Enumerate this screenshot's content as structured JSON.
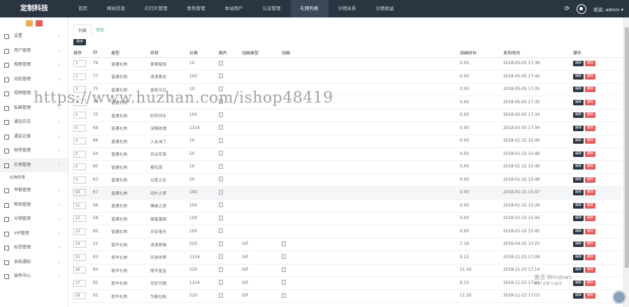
{
  "header": {
    "brand": "定制科技",
    "nav": [
      "首页",
      "网站信息",
      "幻灯片管理",
      "角色管理",
      "本站用户",
      "认证管理",
      "礼物列表",
      "分销关系",
      "分销收益"
    ],
    "active_nav_index": 6,
    "user": "欢迎, admin ▾"
  },
  "sidebar": {
    "items": [
      {
        "label": "设置"
      },
      {
        "label": "用户管理"
      },
      {
        "label": "相册管理"
      },
      {
        "label": "动态管理"
      },
      {
        "label": "视频管理"
      },
      {
        "label": "私聊管理"
      },
      {
        "label": "通话日志"
      },
      {
        "label": "通话记录"
      },
      {
        "label": "财务管理"
      },
      {
        "label": "礼物管理"
      },
      {
        "label": "举报管理"
      },
      {
        "label": "帮助管理"
      },
      {
        "label": "分销管理"
      },
      {
        "label": "VIP管理"
      },
      {
        "label": "标签管理"
      },
      {
        "label": "系统通知"
      },
      {
        "label": "插件中心"
      }
    ],
    "active_item_index": 9,
    "sub_item": "礼物列表"
  },
  "main": {
    "tabs": [
      "列表",
      "添加"
    ],
    "sort_button": "排序",
    "columns": [
      "排序",
      "ID",
      "类型",
      "名称",
      "价格",
      "图片",
      "动画类型",
      "动画",
      "动画时长",
      "发布时间",
      "操作"
    ],
    "edit_label": "编辑",
    "delete_label": "删除",
    "rows": [
      {
        "order": "1",
        "id": "76",
        "type": "普通礼物",
        "name": "香薰蜡烛",
        "price": "10",
        "anim_type": "",
        "duration": "0.00",
        "time": "2018-05-05 17:39"
      },
      {
        "order": "2",
        "id": "77",
        "type": "普通礼物",
        "name": "浪漫薰衣",
        "price": "100",
        "anim_type": "",
        "duration": "0.00",
        "time": "2018-05-05 17:40"
      },
      {
        "order": "3",
        "id": "75",
        "type": "普通礼物",
        "name": "香氛头灯",
        "price": "10",
        "anim_type": "",
        "duration": "0.00",
        "time": "2018-05-05 17:35"
      },
      {
        "order": "4",
        "id": "74",
        "type": "普通礼物",
        "name": "",
        "price": "",
        "anim_type": "",
        "duration": "0.00",
        "time": "2018-05-05 17:35"
      },
      {
        "order": "5",
        "id": "70",
        "type": "普通礼物",
        "name": "好转风车",
        "price": "100",
        "anim_type": "",
        "duration": "0.00",
        "time": "2018-05-05 17:34"
      },
      {
        "order": "6",
        "id": "69",
        "type": "普通礼物",
        "name": "深情玫瑰",
        "price": "1314",
        "anim_type": "",
        "duration": "0.00",
        "time": "2018-05-05 17:34"
      },
      {
        "order": "0",
        "id": "66",
        "type": "普通礼物",
        "name": "入会油了",
        "price": "10",
        "anim_type": "",
        "duration": "0.00",
        "time": "2018-01-15 15:49"
      },
      {
        "order": "0",
        "id": "64",
        "type": "普通礼物",
        "name": "百合花束",
        "price": "50",
        "anim_type": "",
        "duration": "0.00",
        "time": "2018-01-15 15:48"
      },
      {
        "order": "0",
        "id": "65",
        "type": "普通礼物",
        "name": "樱花雨",
        "price": "10",
        "anim_type": "",
        "duration": "0.00",
        "time": "2018-01-15 15:48"
      },
      {
        "order": "0",
        "id": "63",
        "type": "普通礼物",
        "name": "以爱之名",
        "price": "50",
        "anim_type": "",
        "duration": "0.00",
        "time": "2018-01-15 15:48"
      },
      {
        "order": "10",
        "id": "67",
        "type": "普通礼物",
        "name": "四叶之草",
        "price": "100",
        "anim_type": "",
        "duration": "0.00",
        "time": "2018-01-15 15:47"
      },
      {
        "order": "11",
        "id": "56",
        "type": "普通礼物",
        "name": "情缘之夜",
        "price": "100",
        "anim_type": "",
        "duration": "0.00",
        "time": "2018-01-15 15:39"
      },
      {
        "order": "12",
        "id": "58",
        "type": "普通礼物",
        "name": "甜蜜蛋糕",
        "price": "100",
        "anim_type": "",
        "duration": "0.00",
        "time": "2018-01-15 15:44"
      },
      {
        "order": "13",
        "id": "60",
        "type": "普通礼物",
        "name": "总有笔仓",
        "price": "100",
        "anim_type": "",
        "duration": "0.00",
        "time": "2018-01-15 15:45"
      },
      {
        "order": "14",
        "id": "22",
        "type": "豪华礼物",
        "name": "浪漫爱情",
        "price": "520",
        "anim_type": "GIF",
        "duration": "7.18",
        "time": "2016-04-25 10:25"
      },
      {
        "order": "15",
        "id": "83",
        "type": "豪华礼物",
        "name": "环游世界",
        "price": "1314",
        "anim_type": "GIF",
        "duration": "9.12",
        "time": "2018-11-23 17:08"
      },
      {
        "order": "16",
        "id": "84",
        "type": "豪华礼物",
        "name": "摩天星音",
        "price": "520",
        "anim_type": "GIF",
        "duration": "11.10",
        "time": "2018-11-23 17:14"
      },
      {
        "order": "17",
        "id": "82",
        "type": "豪华礼物",
        "name": "花好月圆",
        "price": "1314",
        "anim_type": "GIF",
        "duration": "8.10",
        "time": "2018-11-23 17:01"
      },
      {
        "order": "18",
        "id": "81",
        "type": "豪华礼物",
        "name": "为霸在船",
        "price": "520",
        "anim_type": "GIF",
        "duration": "11.20",
        "time": "2018-11-23 17:03"
      }
    ]
  },
  "watermark": "https://www.huzhan.com/ishop48419",
  "windows_activate": {
    "line1": "激活 Windows",
    "line2": "转到\"设置\"以激活"
  }
}
